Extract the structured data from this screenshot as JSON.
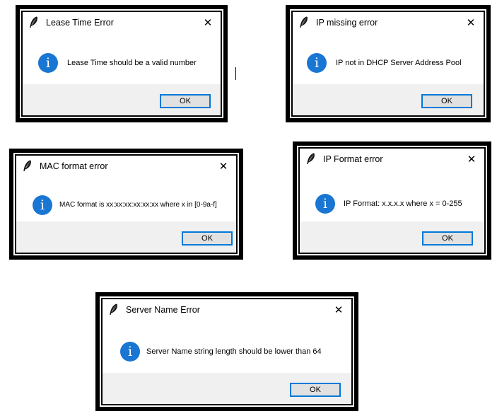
{
  "dialogs": [
    {
      "title": "Lease Time Error",
      "message": "Lease Time should be a valid number",
      "ok_label": "OK",
      "close_glyph": "✕",
      "info_glyph": "i",
      "icon": "feather-icon"
    },
    {
      "title": "IP missing error",
      "message": "IP not in DHCP Server Address Pool",
      "ok_label": "OK",
      "close_glyph": "✕",
      "info_glyph": "i",
      "icon": "feather-icon"
    },
    {
      "title": "MAC format error",
      "message": "MAC format is xx:xx:xx:xx:xx:xx where x in [0-9a-f]",
      "ok_label": "OK",
      "close_glyph": "✕",
      "info_glyph": "i",
      "icon": "feather-icon"
    },
    {
      "title": "IP Format error",
      "message": "IP Format: x.x.x.x where x = 0-255",
      "ok_label": "OK",
      "close_glyph": "✕",
      "info_glyph": "i",
      "icon": "feather-icon"
    },
    {
      "title": "Server Name Error",
      "message": "Server Name string length should be lower than 64",
      "ok_label": "OK",
      "close_glyph": "✕",
      "info_glyph": "i",
      "icon": "feather-icon"
    }
  ],
  "colors": {
    "info_icon": "#1976d2",
    "footer": "#f0f0f0",
    "ok_border": "#0078d7"
  }
}
